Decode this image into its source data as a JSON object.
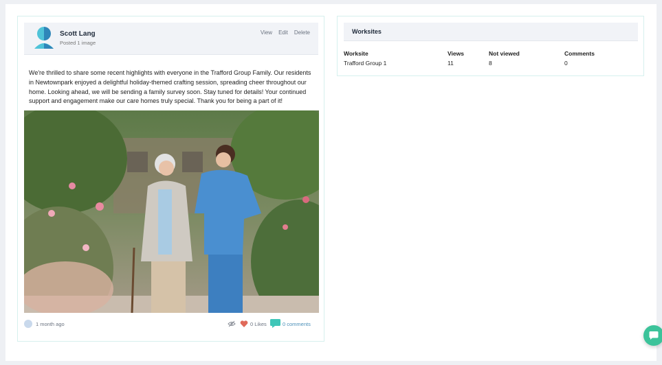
{
  "post": {
    "author": "Scott Lang",
    "subtitle": "Posted 1 image",
    "actions": {
      "view": "View",
      "edit": "Edit",
      "delete": "Delete"
    },
    "body": "We're thrilled to share some recent highlights with everyone in the Trafford Group Family. Our residents in Newtownpark enjoyed a delightful holiday-themed crafting session, spreading cheer throughout our home. Looking ahead, we will be sending a family survey soon. Stay tuned for details! Your continued support and engagement make our care homes truly special. Thank you for being a part of it!",
    "time": "1 month ago",
    "likes": "0 Likes",
    "comments": "0 comments"
  },
  "worksites": {
    "title": "Worksites",
    "columns": [
      "Worksite",
      "Views",
      "Not viewed",
      "Comments"
    ],
    "rows": [
      {
        "worksite": "Trafford Group 1",
        "views": "11",
        "not_viewed": "8",
        "comments": "0"
      }
    ]
  },
  "colors": {
    "accent": "#3cc39a",
    "heart": "#e06a5a",
    "comment": "#3fc6b8",
    "avatar_light": "#4fc3d8",
    "avatar_dark": "#2f86b9"
  },
  "icons": {
    "avatar": "avatar-logo-icon",
    "time": "clock-icon",
    "hidden": "eye-off-icon",
    "like": "heart-icon",
    "comment": "comment-icon",
    "chat": "chat-icon"
  }
}
